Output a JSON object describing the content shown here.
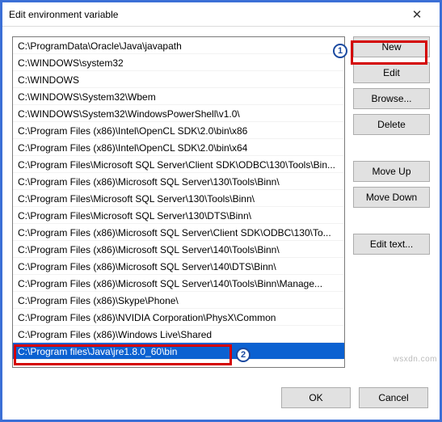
{
  "window": {
    "title": "Edit environment variable",
    "close_glyph": "✕"
  },
  "list": {
    "items": [
      "C:\\ProgramData\\Oracle\\Java\\javapath",
      "C:\\WINDOWS\\system32",
      "C:\\WINDOWS",
      "C:\\WINDOWS\\System32\\Wbem",
      "C:\\WINDOWS\\System32\\WindowsPowerShell\\v1.0\\",
      "C:\\Program Files (x86)\\Intel\\OpenCL SDK\\2.0\\bin\\x86",
      "C:\\Program Files (x86)\\Intel\\OpenCL SDK\\2.0\\bin\\x64",
      "C:\\Program Files\\Microsoft SQL Server\\Client SDK\\ODBC\\130\\Tools\\Bin...",
      "C:\\Program Files (x86)\\Microsoft SQL Server\\130\\Tools\\Binn\\",
      "C:\\Program Files\\Microsoft SQL Server\\130\\Tools\\Binn\\",
      "C:\\Program Files\\Microsoft SQL Server\\130\\DTS\\Binn\\",
      "C:\\Program Files (x86)\\Microsoft SQL Server\\Client SDK\\ODBC\\130\\To...",
      "C:\\Program Files (x86)\\Microsoft SQL Server\\140\\Tools\\Binn\\",
      "C:\\Program Files (x86)\\Microsoft SQL Server\\140\\DTS\\Binn\\",
      "C:\\Program Files (x86)\\Microsoft SQL Server\\140\\Tools\\Binn\\Manage...",
      "C:\\Program Files (x86)\\Skype\\Phone\\",
      "C:\\Program Files (x86)\\NVIDIA Corporation\\PhysX\\Common",
      "C:\\Program Files (x86)\\Windows Live\\Shared",
      "C:\\Program files\\Java\\jre1.8.0_60\\bin"
    ],
    "selected_index": 18
  },
  "buttons": {
    "new": "New",
    "edit": "Edit",
    "browse": "Browse...",
    "delete": "Delete",
    "moveup": "Move Up",
    "movedown": "Move Down",
    "edittext": "Edit text...",
    "ok": "OK",
    "cancel": "Cancel"
  },
  "annotations": {
    "badge1": "1",
    "badge2": "2"
  },
  "watermark": "wsxdn.com"
}
